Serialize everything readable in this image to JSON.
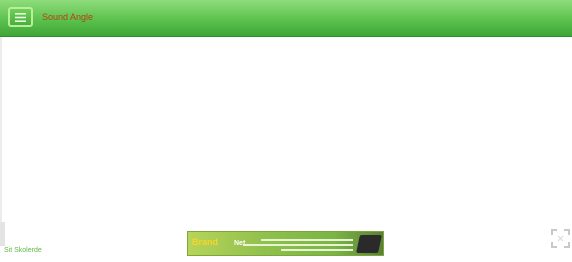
{
  "header": {
    "title": "Sound Angle",
    "menu_icon": "menu-icon",
    "colors": {
      "bar_top": "#8fdc7b",
      "bar_bottom": "#3fa537",
      "title": "#b4410e"
    }
  },
  "footer": {
    "link_text": "Sit Skolerde"
  },
  "ad": {
    "left_text": "Brand",
    "right_text": "Net",
    "device_icon": "tablet-icon"
  },
  "controls": {
    "fullscreen_icon": "fullscreen-icon"
  }
}
